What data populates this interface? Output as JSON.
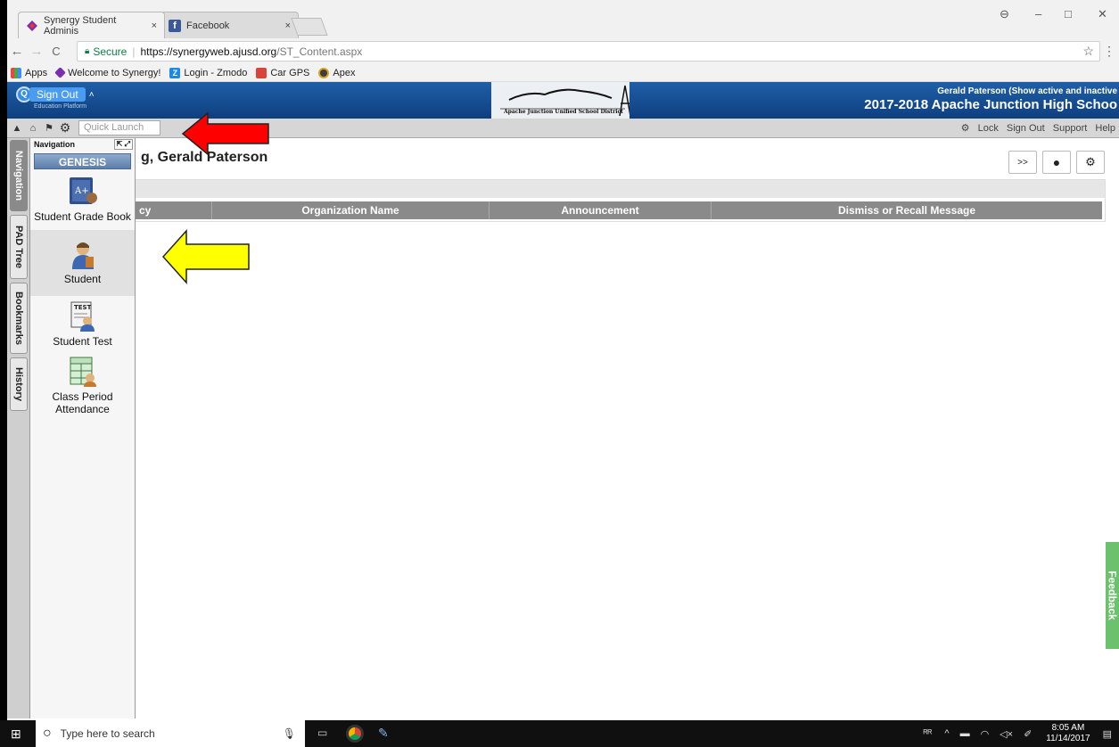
{
  "browser": {
    "tabs": [
      {
        "label": "Synergy Student Adminis",
        "close": "×"
      },
      {
        "label": "Facebook",
        "close": "×"
      }
    ],
    "window_controls": {
      "profile": "⊖",
      "minimize": "–",
      "maximize": "□",
      "close": "✕"
    },
    "nav": {
      "back": "←",
      "forward": "→",
      "reload": "C"
    },
    "address": {
      "secure_label": "Secure",
      "host": "https://synergyweb.ajusd.org",
      "path": "/ST_Content.aspx"
    },
    "bookmarks": [
      "Apps",
      "Welcome to Synergy!",
      "Login - Zmodo",
      "Car GPS",
      "Apex"
    ]
  },
  "header": {
    "signout_label": "Sign Out",
    "platform_label": "Education Platform",
    "district_logo_text": "Apache Junction Unified School District",
    "user_line": "Gerald Paterson (Show active and inactive",
    "school_line": "2017-2018 Apache Junction High Schoo"
  },
  "toolbar": {
    "quick_launch_placeholder": "Quick Launch",
    "links": [
      "Lock",
      "Sign Out",
      "Support",
      "Help"
    ]
  },
  "vertical_tabs": [
    "Navigation",
    "PAD Tree",
    "Bookmarks",
    "History"
  ],
  "nav_panel": {
    "title": "Navigation",
    "group": "GENESIS",
    "items": [
      {
        "label": "Student Grade Book",
        "icon": "gradebook-icon"
      },
      {
        "label": "Student",
        "icon": "student-icon"
      },
      {
        "label": "Student Test",
        "icon": "student-test-icon"
      },
      {
        "label": "Class Period Attendance",
        "icon": "attendance-icon"
      }
    ]
  },
  "main": {
    "title": "g, Gerald Paterson",
    "buttons": [
      ">>",
      "●",
      "⚙"
    ],
    "columns": [
      "cy",
      "Organization Name",
      "Announcement",
      "Dismiss or Recall Message"
    ],
    "feedback_label": "Feedback"
  },
  "taskbar": {
    "search_placeholder": "Type here to search",
    "time": "8:05 AM",
    "date": "11/14/2017"
  },
  "colors": {
    "header_blue": "#1f5fa8",
    "arrow_red": "#ff0000",
    "arrow_yellow": "#ffff00",
    "feedback_green": "#6cc26c"
  }
}
